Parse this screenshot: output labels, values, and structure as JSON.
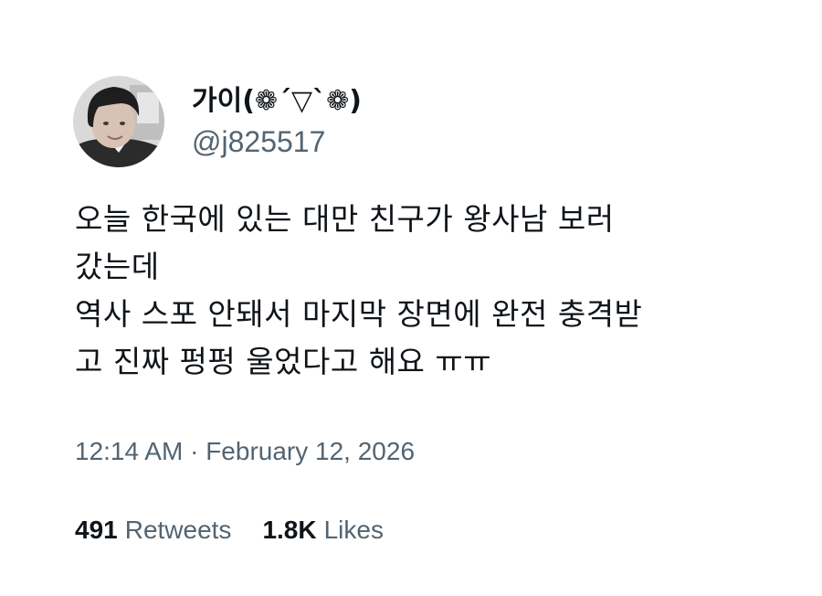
{
  "user": {
    "display_name": "가이(❁´▽`❁)",
    "handle": "@j825517"
  },
  "tweet": {
    "lines": [
      "오늘 한국에 있는 대만 친구가 왕사남 보러",
      "갔는데",
      "역사 스포 안돼서 마지막 장면에 완전 충격받",
      "고 진짜 펑펑 울었다고 해요 ㅠㅠ"
    ],
    "time": "12:14 AM",
    "separator": "·",
    "date": "February 12, 2026"
  },
  "stats": {
    "retweets_count": "491",
    "retweets_label": "Retweets",
    "likes_count": "1.8K",
    "likes_label": "Likes"
  },
  "icons": {
    "avatar": "profile-photo"
  },
  "colors": {
    "text_primary": "#0f1419",
    "text_secondary": "#536471",
    "background": "#ffffff"
  }
}
